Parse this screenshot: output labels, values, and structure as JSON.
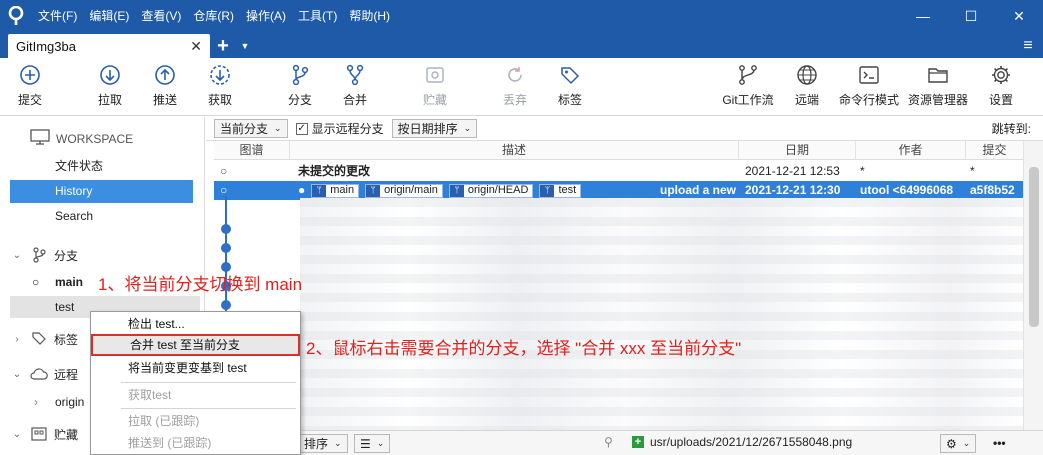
{
  "menu": [
    "文件(F)",
    "编辑(E)",
    "查看(V)",
    "仓库(R)",
    "操作(A)",
    "工具(T)",
    "帮助(H)"
  ],
  "window": {
    "minimize": "—",
    "maximize": "☐",
    "close": "✕"
  },
  "tab": {
    "title": "GitImg3ba",
    "close": "✕",
    "add": "+",
    "dropdown": "▼",
    "menu": "≡"
  },
  "toolbar": {
    "commit": "提交",
    "pull": "拉取",
    "push": "推送",
    "fetch": "获取",
    "branch": "分支",
    "merge": "合并",
    "stash": "贮藏",
    "discard": "丢弃",
    "tag": "标签",
    "gitflow": "Git工作流",
    "remote": "远端",
    "terminal": "命令行模式",
    "explorer": "资源管理器",
    "settings": "设置"
  },
  "sidebar": {
    "workspace": "WORKSPACE",
    "items": [
      "文件状态",
      "History",
      "Search"
    ],
    "branches_title": "分支",
    "branches": [
      "main",
      "test"
    ],
    "tags_title": "标签",
    "remotes_title": "远程",
    "remote_origin": "origin",
    "stash_title": "贮藏"
  },
  "filter": {
    "branch_dd": "当前分支",
    "show_remote": "显示远程分支",
    "sort_dd": "按日期排序",
    "jump": "跳转到:"
  },
  "columns": {
    "graph": "图谱",
    "desc": "描述",
    "date": "日期",
    "author": "作者",
    "commit": "提交"
  },
  "commits": [
    {
      "desc": "未提交的更改",
      "date": "2021-12-21 12:53",
      "author": "*",
      "hash": "*"
    },
    {
      "refs": [
        "main",
        "origin/main",
        "origin/HEAD",
        "test"
      ],
      "desc": "upload a new",
      "date": "2021-12-21 12:30",
      "author": "utool <64996068",
      "hash": "a5f8b52"
    }
  ],
  "bottom": {
    "sort_dd": "排序",
    "file": "usr/uploads/2021/12/2671558048.png",
    "more": "•••"
  },
  "context_menu": [
    {
      "label": "检出 test...",
      "disabled": false
    },
    {
      "label": "合并 test 至当前分支",
      "disabled": false
    },
    {
      "label": "将当前变更变基到 test",
      "disabled": false
    },
    {
      "label": "获取test",
      "disabled": true
    },
    {
      "label": "拉取 (已跟踪)",
      "disabled": true
    },
    {
      "label": "推送到 (已跟踪)",
      "disabled": true
    }
  ],
  "annotations": {
    "step1": "1、将当前分支切换到 main",
    "step2": "2、鼠标右击需要合并的分支，选择 \"合并 xxx 至当前分支\""
  },
  "colors": {
    "titlebar": "#1f5aa8",
    "selection": "#2f80d8",
    "sidebar_active": "#3b8ee0",
    "annotation": "#e0201c"
  }
}
